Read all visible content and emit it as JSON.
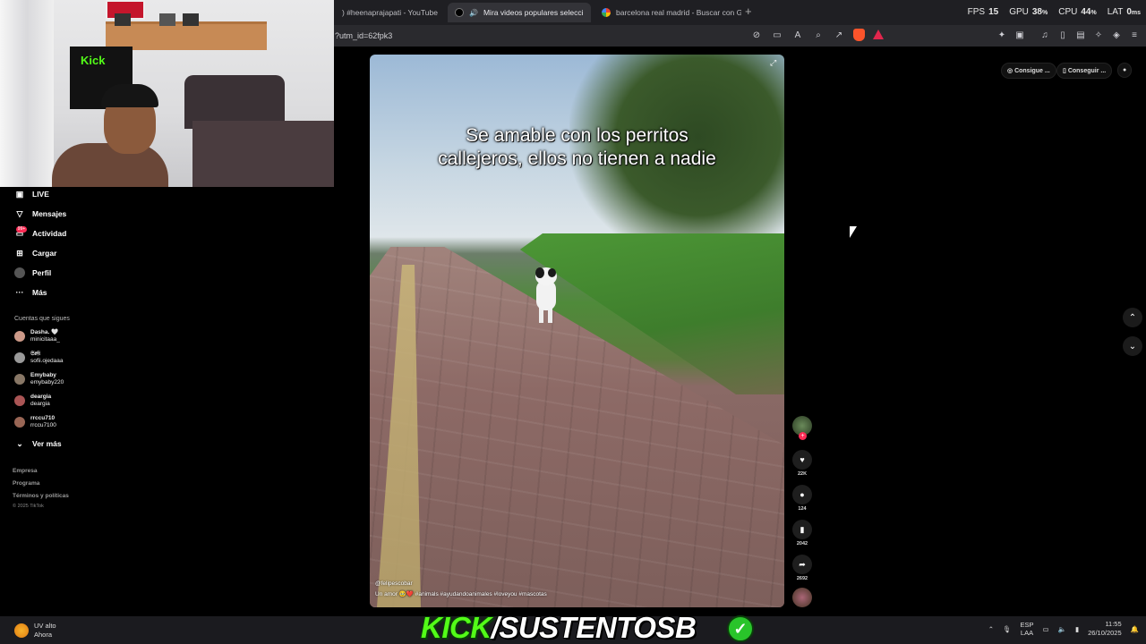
{
  "browser": {
    "tabs": [
      {
        "title": ") #heenaprajapati - YouTube",
        "active": false
      },
      {
        "title": "Mira videos populares selecci",
        "active": true
      },
      {
        "title": "barcelona real madrid - Buscar con G",
        "active": false
      }
    ],
    "url": "?utm_id=62fpk3"
  },
  "perf": {
    "fps_label": "FPS",
    "fps": "15",
    "gpu_label": "GPU",
    "gpu": "38",
    "gpu_unit": "%",
    "cpu_label": "CPU",
    "cpu": "44",
    "cpu_unit": "%",
    "lat_label": "LAT",
    "lat": "0",
    "lat_unit": "ms"
  },
  "sidebar": {
    "items": [
      {
        "label": "LIVE",
        "icon": "live-icon"
      },
      {
        "label": "Mensajes",
        "icon": "send-icon"
      },
      {
        "label": "Actividad",
        "icon": "inbox-icon",
        "badge": "99+"
      },
      {
        "label": "Cargar",
        "icon": "upload-icon"
      },
      {
        "label": "Perfil",
        "icon": "profile-icon"
      },
      {
        "label": "Más",
        "icon": "more-icon"
      }
    ],
    "following_title": "Cuentas que sigues",
    "following": [
      {
        "name": "Dasha. 🤍",
        "handle": "minicitaaa_"
      },
      {
        "name": "𝔖𝔬𝔣𝔦",
        "handle": "sofii.ojedaaa"
      },
      {
        "name": "Emybaby",
        "handle": "emybaby220"
      },
      {
        "name": "deargia",
        "handle": "deargia"
      },
      {
        "name": "rrccu710",
        "handle": "rrccu7100"
      }
    ],
    "see_more": "Ver más",
    "footer": [
      "Empresa",
      "Programa",
      "Términos y políticas"
    ],
    "copyright": "© 2025 TikTok"
  },
  "video": {
    "caption": "Se amable con los perritos callejeros, ellos no tienen a nadie",
    "author": "@felipescobar",
    "description": "Un amor 🥹❤️ #animals #ayudandoanimales #loveyou #mascotas"
  },
  "actions": {
    "likes": "22K",
    "comments": "124",
    "saves": "2042",
    "shares": "2692"
  },
  "top_right": {
    "coins": "Consigue ...",
    "app": "Conseguir ..."
  },
  "webcam": {
    "flag_text": "Kick"
  },
  "taskbar": {
    "weather_title": "UV alto",
    "weather_sub": "Ahora",
    "lang_top": "ESP",
    "lang_bottom": "LAA",
    "time": "11:55",
    "date": "26/10/2025"
  },
  "banner": {
    "part1": "KICK",
    "part2": "/",
    "part3": "SUSTENTOSB"
  }
}
